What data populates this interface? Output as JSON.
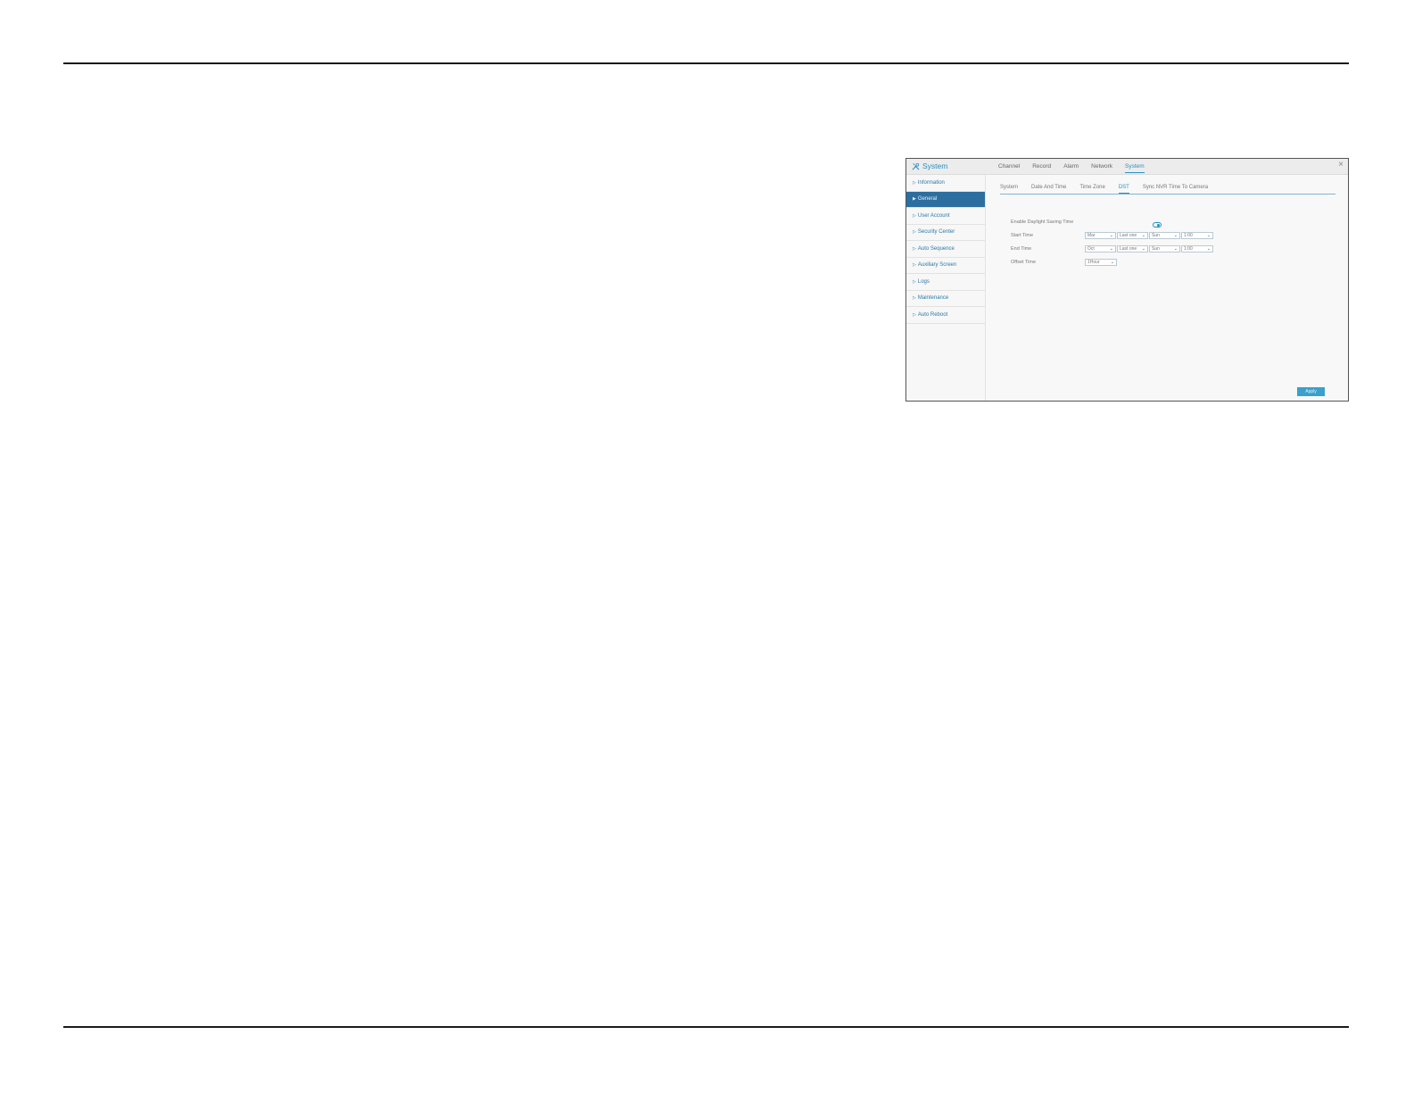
{
  "window": {
    "title": "System",
    "close_glyph": "×",
    "tabs": [
      "Channel",
      "Record",
      "Alarm",
      "Network",
      "System"
    ],
    "active_tab": "System"
  },
  "sidebar": {
    "items": [
      {
        "label": "Information",
        "active": false
      },
      {
        "label": "General",
        "active": true
      },
      {
        "label": "User Account",
        "active": false
      },
      {
        "label": "Security Center",
        "active": false
      },
      {
        "label": "Auto Sequence",
        "active": false
      },
      {
        "label": "Auxiliary Screen",
        "active": false
      },
      {
        "label": "Logs",
        "active": false
      },
      {
        "label": "Maintenance",
        "active": false
      },
      {
        "label": "Auto Reboot",
        "active": false
      }
    ]
  },
  "sub_tabs": {
    "items": [
      "System",
      "Date And Time",
      "Time Zone",
      "DST",
      "Sync NVR Time To Camera"
    ],
    "active": "DST"
  },
  "form": {
    "enable_label": "Enable Daylight Saving Time",
    "enable_on": true,
    "start_label": "Start Time",
    "start": {
      "month": "Mar",
      "week": "Last one",
      "day": "Sun",
      "time": "1:00"
    },
    "end_label": "End Time",
    "end": {
      "month": "Oct",
      "week": "Last one",
      "day": "Sun",
      "time": "1:00"
    },
    "offset_label": "Offset Time",
    "offset": "1Hour"
  },
  "apply_label": "Apply",
  "icons": {
    "logo": "wrench-screwdriver-icon",
    "chevron": "chevron-down-icon"
  },
  "colors": {
    "accent": "#2a8fbf",
    "active_item": "#2c6ea0",
    "apply": "#3aa0cc"
  }
}
